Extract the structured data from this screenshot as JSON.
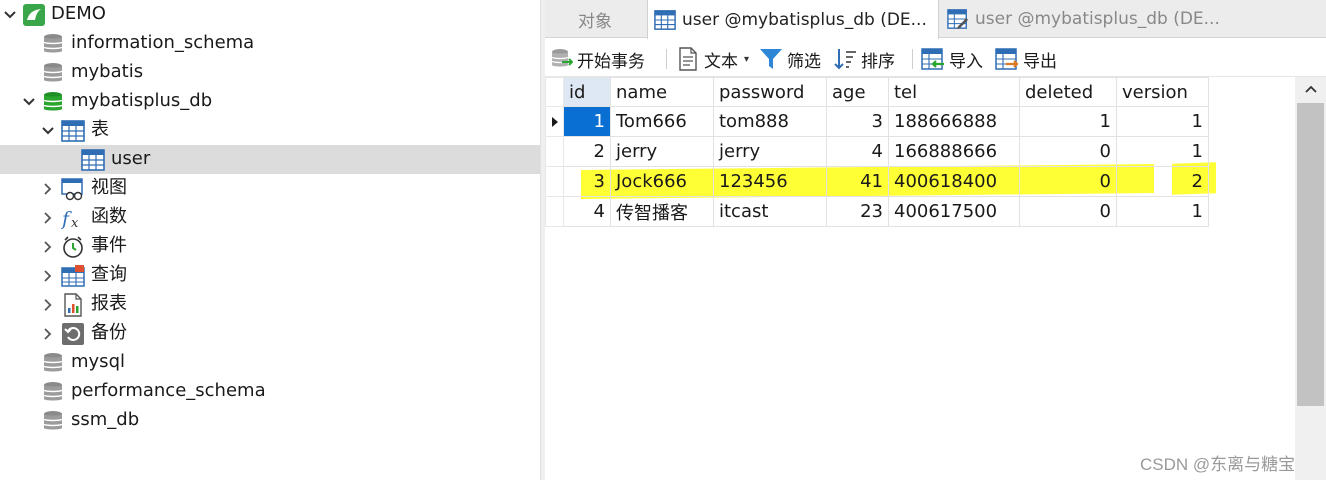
{
  "tree": {
    "connection": {
      "label": "DEMO",
      "icon": "connection-icon"
    },
    "databases": [
      {
        "label": "information_schema",
        "icon": "database-icon"
      },
      {
        "label": "mybatis",
        "icon": "database-icon"
      },
      {
        "label": "mybatisplus_db",
        "icon": "database-open-icon"
      }
    ],
    "open_db_children": [
      {
        "label": "表",
        "icon": "tables-icon"
      },
      {
        "label": "user",
        "icon": "table-icon"
      },
      {
        "label": "视图",
        "icon": "view-icon"
      },
      {
        "label": "函数",
        "icon": "function-icon"
      },
      {
        "label": "事件",
        "icon": "event-icon"
      },
      {
        "label": "查询",
        "icon": "query-icon"
      },
      {
        "label": "报表",
        "icon": "report-icon"
      },
      {
        "label": "备份",
        "icon": "backup-icon"
      }
    ],
    "more_databases": [
      {
        "label": "mysql",
        "icon": "database-icon"
      },
      {
        "label": "performance_schema",
        "icon": "database-icon"
      },
      {
        "label": "ssm_db",
        "icon": "database-icon"
      }
    ]
  },
  "tabs": [
    {
      "label": "对象"
    },
    {
      "label": "user @mybatisplus_db (DE..."
    },
    {
      "label": "user @mybatisplus_db (DE..."
    }
  ],
  "toolbar": {
    "begin_transaction": "开始事务",
    "text": "文本",
    "filter": "筛选",
    "sort": "排序",
    "import": "导入",
    "export": "导出"
  },
  "grid": {
    "columns": [
      "id",
      "name",
      "password",
      "age",
      "tel",
      "deleted",
      "version"
    ],
    "rows": [
      [
        "1",
        "Tom666",
        "tom888",
        "3",
        "188666888",
        "1",
        "1"
      ],
      [
        "2",
        "jerry",
        "jerry",
        "4",
        "166888666",
        "0",
        "1"
      ],
      [
        "3",
        "Jock666",
        "123456",
        "41",
        "400618400",
        "0",
        "2"
      ],
      [
        "4",
        "传智播客",
        "itcast",
        "23",
        "400617500",
        "0",
        "1"
      ]
    ]
  },
  "colors": {
    "selected_cell": "#0a6fd3",
    "highlight": "#ffff2a",
    "db_open": "#2aa52e",
    "accent_blue": "#2f6db5"
  },
  "watermark": "CSDN @东离与糖宝"
}
